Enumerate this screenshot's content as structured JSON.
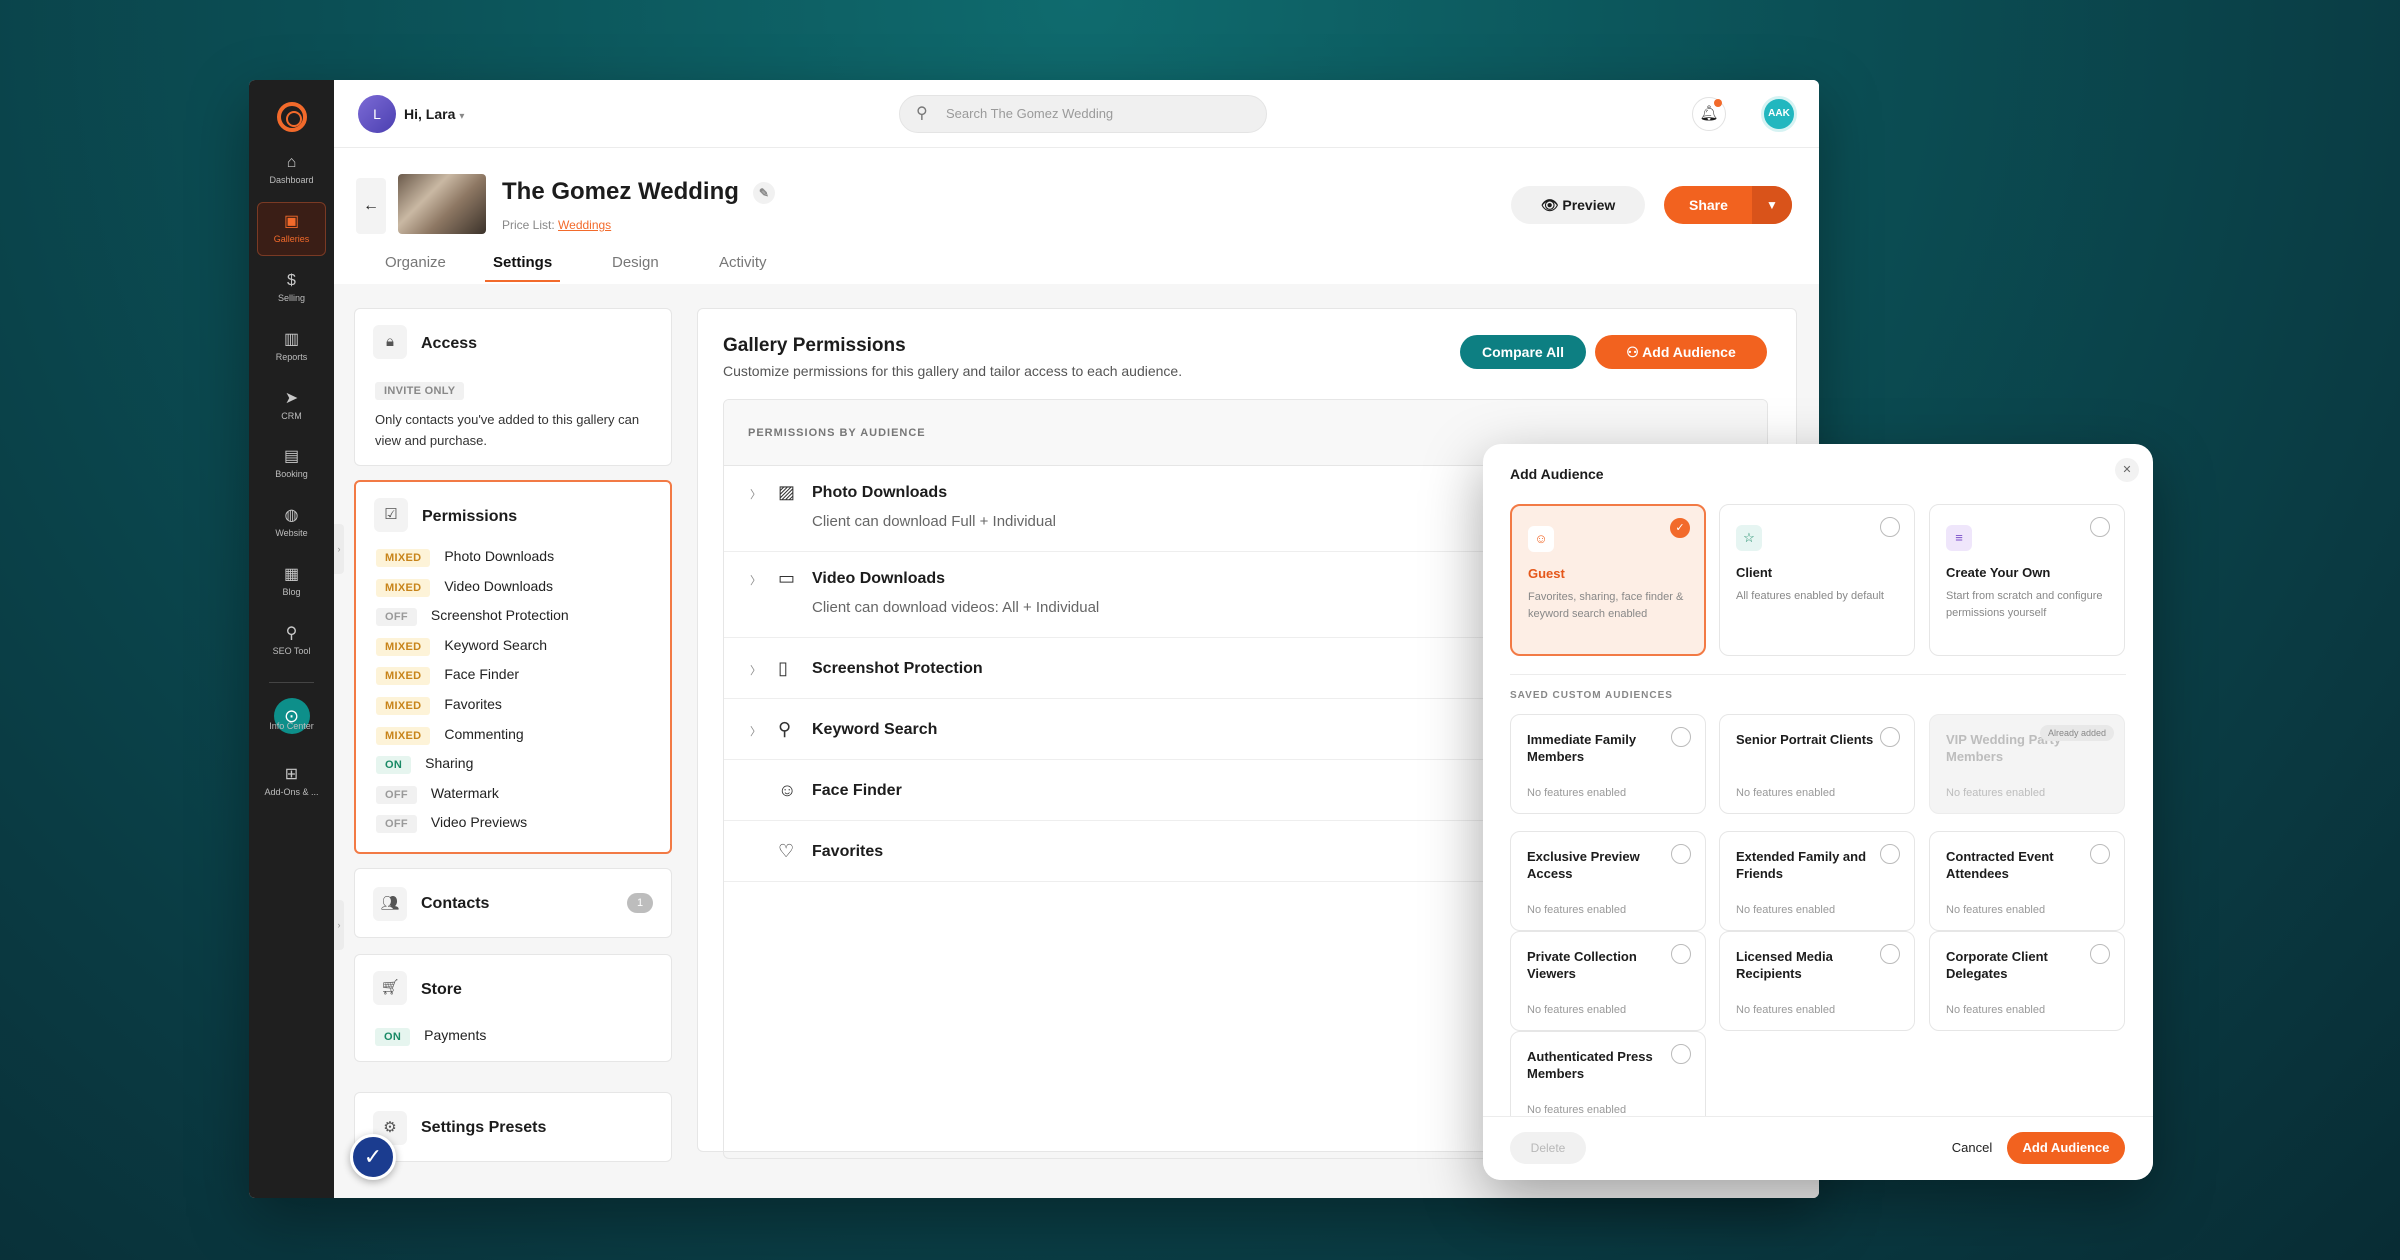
{
  "rail": {
    "items": [
      {
        "label": "Dashboard",
        "icon": "⌂",
        "name": "dashboard"
      },
      {
        "label": "Galleries",
        "icon": "▣",
        "name": "galleries"
      },
      {
        "label": "Selling",
        "icon": "$",
        "name": "selling"
      },
      {
        "label": "Reports",
        "icon": "▥",
        "name": "reports"
      },
      {
        "label": "CRM",
        "icon": "➤",
        "name": "crm"
      },
      {
        "label": "Booking",
        "icon": "▤",
        "name": "booking"
      },
      {
        "label": "Website",
        "icon": "◍",
        "name": "website"
      },
      {
        "label": "Blog",
        "icon": "▦",
        "name": "blog"
      },
      {
        "label": "SEO Tool",
        "icon": "⚲",
        "name": "seo-tool"
      }
    ],
    "info_center": "Info Center",
    "addons": "Add-Ons & ..."
  },
  "topbar": {
    "avatar_initial": "L",
    "greeting": "Hi, Lara",
    "search_placeholder": "Search The Gomez Wedding",
    "user_badge": "AAK"
  },
  "header": {
    "title": "The Gomez Wedding",
    "price_list_label": "Price List:",
    "price_list_value": "Weddings",
    "tabs": [
      "Organize",
      "Settings",
      "Design",
      "Activity"
    ],
    "active_tab": "Settings",
    "preview_label": "Preview",
    "share_label": "Share"
  },
  "left": {
    "access": {
      "title": "Access",
      "badge": "INVITE ONLY",
      "desc": "Only contacts you've added to this gallery can view and purchase."
    },
    "permissions": {
      "title": "Permissions",
      "items": [
        {
          "status": "MIXED",
          "label": "Photo Downloads"
        },
        {
          "status": "MIXED",
          "label": "Video Downloads"
        },
        {
          "status": "OFF",
          "label": "Screenshot Protection"
        },
        {
          "status": "MIXED",
          "label": "Keyword Search"
        },
        {
          "status": "MIXED",
          "label": "Face Finder"
        },
        {
          "status": "MIXED",
          "label": "Favorites"
        },
        {
          "status": "MIXED",
          "label": "Commenting"
        },
        {
          "status": "ON",
          "label": "Sharing"
        },
        {
          "status": "OFF",
          "label": "Watermark"
        },
        {
          "status": "OFF",
          "label": "Video Previews"
        }
      ]
    },
    "contacts": {
      "title": "Contacts",
      "count": "1"
    },
    "store": {
      "title": "Store",
      "status": "ON",
      "label": "Payments"
    },
    "presets": {
      "title": "Settings Presets"
    }
  },
  "main": {
    "title": "Gallery Permissions",
    "subtitle": "Customize permissions for this gallery and tailor access to each audience.",
    "compare_label": "Compare All",
    "add_audience_label": "Add Audience",
    "table_header": "PERMISSIONS BY AUDIENCE",
    "rows": [
      {
        "name": "Photo Downloads",
        "desc": "Client can download Full + Individual",
        "icon": "▨",
        "expand": true
      },
      {
        "name": "Video Downloads",
        "desc": "Client can download videos: All + Individual",
        "icon": "▭",
        "expand": true
      },
      {
        "name": "Screenshot Protection",
        "desc": "",
        "icon": "▯",
        "expand": true
      },
      {
        "name": "Keyword Search",
        "desc": "",
        "icon": "⚲",
        "expand": true
      },
      {
        "name": "Face Finder",
        "desc": "",
        "icon": "☺",
        "expand": false
      },
      {
        "name": "Favorites",
        "desc": "",
        "icon": "♡",
        "expand": false
      }
    ]
  },
  "modal": {
    "title": "Add Audience",
    "options": [
      {
        "name": "Guest",
        "desc": "Favorites, sharing, face finder & keyword search enabled",
        "icon": "☺",
        "selected": true
      },
      {
        "name": "Client",
        "desc": "All features enabled by default",
        "icon": "☆",
        "selected": false
      },
      {
        "name": "Create Your Own",
        "desc": "Start from scratch and configure permissions yourself",
        "icon": "≡",
        "selected": false
      }
    ],
    "saved_label": "SAVED CUSTOM AUDIENCES",
    "saved": [
      {
        "name": "Immediate Family Members",
        "desc": "No features enabled",
        "disabled": false
      },
      {
        "name": "Senior Portrait Clients",
        "desc": "No features enabled",
        "disabled": false
      },
      {
        "name": "VIP Wedding Party Members",
        "desc": "No features enabled",
        "disabled": true
      },
      {
        "name": "Exclusive Preview Access",
        "desc": "No features enabled",
        "disabled": false
      },
      {
        "name": "Extended Family and Friends",
        "desc": "No features enabled",
        "disabled": false
      },
      {
        "name": "Contracted Event Attendees",
        "desc": "No features enabled",
        "disabled": false
      },
      {
        "name": "Private Collection Viewers",
        "desc": "No features enabled",
        "disabled": false
      },
      {
        "name": "Licensed Media Recipients",
        "desc": "No features enabled",
        "disabled": false
      },
      {
        "name": "Corporate Client Delegates",
        "desc": "No features enabled",
        "disabled": false
      },
      {
        "name": "Authenticated Press Members",
        "desc": "No features enabled",
        "disabled": false
      }
    ],
    "already_added": "Already added",
    "delete_label": "Delete",
    "cancel_label": "Cancel",
    "add_label": "Add Audience"
  },
  "colors": {
    "accent": "#f2621f",
    "teal": "#0d7f82",
    "rail": "#1f1f1f"
  }
}
